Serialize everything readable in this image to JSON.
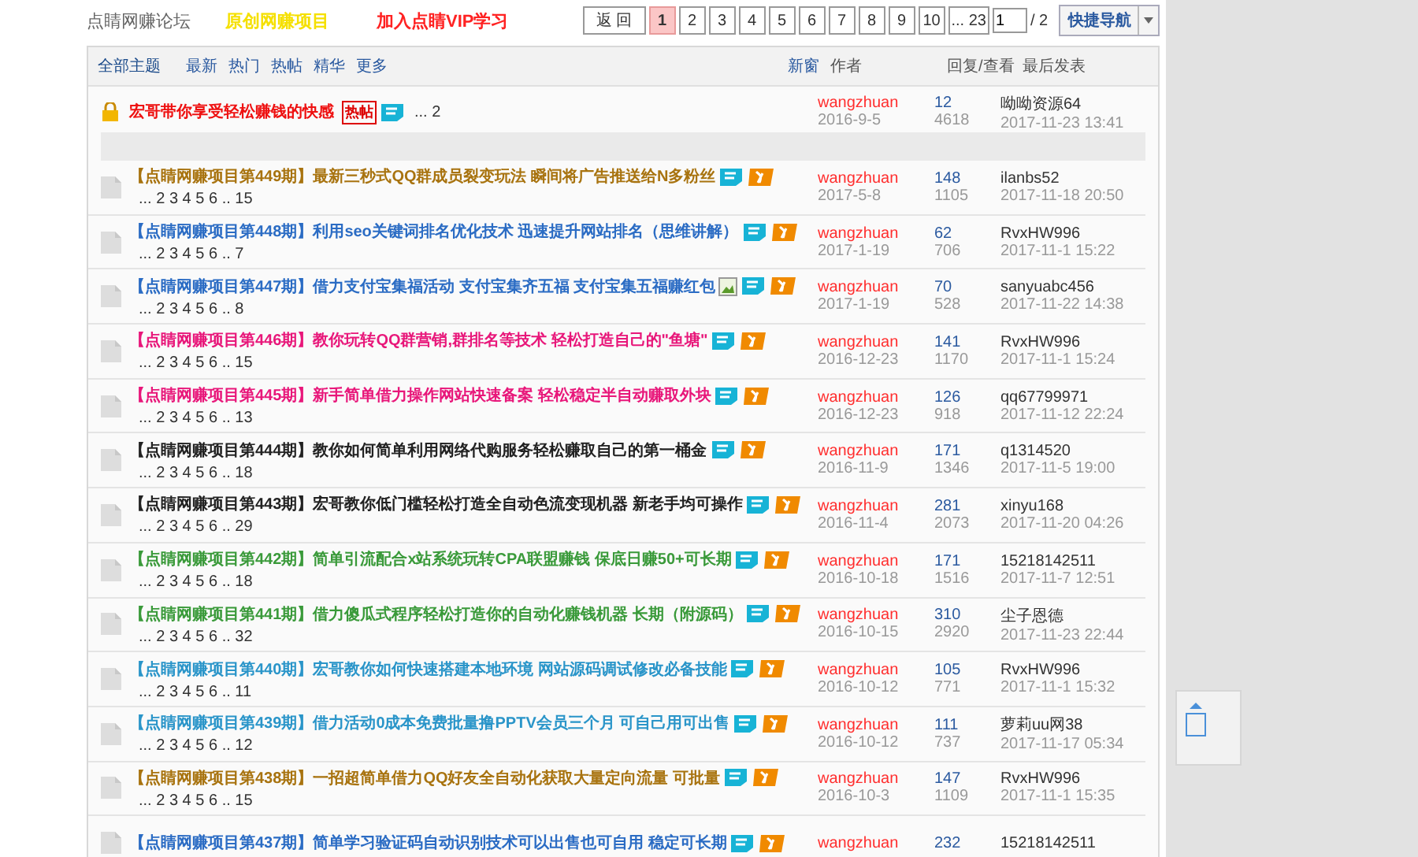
{
  "top_links": [
    {
      "label": "点睛网赚论坛",
      "color": "#666666"
    },
    {
      "label": "原创网赚项目",
      "color": "#f5e000"
    },
    {
      "label": "加入点睛VIP学习",
      "color": "#ff2222"
    }
  ],
  "pager": {
    "back": "返 回",
    "pages": [
      {
        "label": "1",
        "selected": true
      },
      {
        "label": "2",
        "selected": false
      },
      {
        "label": "3",
        "selected": false
      },
      {
        "label": "4",
        "selected": false
      },
      {
        "label": "5",
        "selected": false
      },
      {
        "label": "6",
        "selected": false
      },
      {
        "label": "7",
        "selected": false
      },
      {
        "label": "8",
        "selected": false
      },
      {
        "label": "9",
        "selected": false
      },
      {
        "label": "10",
        "selected": false
      },
      {
        "label": "... 23",
        "selected": false
      }
    ],
    "page_input": "1",
    "total": "/ 2",
    "quick_nav": "快捷导航"
  },
  "header": {
    "filters": [
      {
        "label": "全部主题",
        "selected": true
      },
      {
        "label": "最新",
        "selected": false
      },
      {
        "label": "热门",
        "selected": false
      },
      {
        "label": "热帖",
        "selected": false
      },
      {
        "label": "精华",
        "selected": false
      },
      {
        "label": "更多",
        "selected": false
      }
    ],
    "new_window": "新窗",
    "author": "作者",
    "replies_views": "回复/查看",
    "last_post": "最后发表"
  },
  "sticky": {
    "title": "宏哥带你享受轻松赚钱的快感",
    "tag": "热帖",
    "digest": true,
    "pages": "... 2",
    "author": "wangzhuan",
    "date": "2016-9-5",
    "replies": "12",
    "views": "4618",
    "last_user": "呦呦资源64",
    "last_time": "2017-11-23 13:41"
  },
  "threads": [
    {
      "prefix": "【点睛网赚项目第449期】",
      "title": "最新三秒式QQ群成员裂变玩法 瞬间将广告推送给N多粉丝",
      "color": "#a8730f",
      "has_image": false,
      "digest": true,
      "hot": true,
      "pages": "... 2 3 4 5 6 .. 15",
      "author": "wangzhuan",
      "date": "2017-5-8",
      "replies": "148",
      "views": "1105",
      "last_user": "ilanbs52",
      "last_time": "2017-11-18 20:50"
    },
    {
      "prefix": "【点睛网赚项目第448期】",
      "title": "利用seo关键词排名优化技术 迅速提升网站排名（思维讲解）",
      "color": "#2b6cc4",
      "has_image": false,
      "digest": true,
      "hot": true,
      "pages": "... 2 3 4 5 6 .. 7",
      "author": "wangzhuan",
      "date": "2017-1-19",
      "replies": "62",
      "views": "706",
      "last_user": "RvxHW996",
      "last_time": "2017-11-1 15:22"
    },
    {
      "prefix": "【点睛网赚项目第447期】",
      "title": "借力支付宝集福活动 支付宝集齐五福 支付宝集五福赚红包",
      "color": "#2b6cc4",
      "has_image": true,
      "digest": true,
      "hot": true,
      "pages": "... 2 3 4 5 6 .. 8",
      "author": "wangzhuan",
      "date": "2017-1-19",
      "replies": "70",
      "views": "528",
      "last_user": "sanyuabc456",
      "last_time": "2017-11-22 14:38"
    },
    {
      "prefix": "【点睛网赚项目第446期】",
      "title": "教你玩转QQ群营销,群排名等技术 轻松打造自己的\"鱼塘\"",
      "color": "#e8177a",
      "has_image": false,
      "digest": true,
      "hot": true,
      "pages": "... 2 3 4 5 6 .. 15",
      "author": "wangzhuan",
      "date": "2016-12-23",
      "replies": "141",
      "views": "1170",
      "last_user": "RvxHW996",
      "last_time": "2017-11-1 15:24"
    },
    {
      "prefix": "【点睛网赚项目第445期】",
      "title": "新手简单借力操作网站快速备案 轻松稳定半自动赚取外块",
      "color": "#e8177a",
      "has_image": false,
      "digest": true,
      "hot": true,
      "pages": "... 2 3 4 5 6 .. 13",
      "author": "wangzhuan",
      "date": "2016-12-23",
      "replies": "126",
      "views": "918",
      "last_user": "qq67799971",
      "last_time": "2017-11-12 22:24"
    },
    {
      "prefix": "【点睛网赚项目第444期】",
      "title": "教你如何简单利用网络代购服务轻松赚取自己的第一桶金",
      "color": "#222222",
      "has_image": false,
      "digest": true,
      "hot": true,
      "pages": "... 2 3 4 5 6 .. 18",
      "author": "wangzhuan",
      "date": "2016-11-9",
      "replies": "171",
      "views": "1346",
      "last_user": "q1314520",
      "last_time": "2017-11-5 19:00"
    },
    {
      "prefix": "【点睛网赚项目第443期】",
      "title": "宏哥教你低门槛轻松打造全自动色流变现机器 新老手均可操作",
      "color": "#222222",
      "has_image": false,
      "digest": true,
      "hot": true,
      "pages": "... 2 3 4 5 6 .. 29",
      "author": "wangzhuan",
      "date": "2016-11-4",
      "replies": "281",
      "views": "2073",
      "last_user": "xinyu168",
      "last_time": "2017-11-20 04:26"
    },
    {
      "prefix": "【点睛网赚项目第442期】",
      "title": "简单引流配合x站系统玩转CPA联盟赚钱 保底日赚50+可长期",
      "color": "#3a9a3a",
      "has_image": false,
      "digest": true,
      "hot": true,
      "pages": "... 2 3 4 5 6 .. 18",
      "author": "wangzhuan",
      "date": "2016-10-18",
      "replies": "171",
      "views": "1516",
      "last_user": "15218142511",
      "last_time": "2017-11-7 12:51"
    },
    {
      "prefix": "【点睛网赚项目第441期】",
      "title": "借力傻瓜式程序轻松打造你的自动化赚钱机器 长期（附源码）",
      "color": "#3a9a3a",
      "has_image": false,
      "digest": true,
      "hot": true,
      "pages": "... 2 3 4 5 6 .. 32",
      "author": "wangzhuan",
      "date": "2016-10-15",
      "replies": "310",
      "views": "2920",
      "last_user": "尘子恩德",
      "last_time": "2017-11-23 22:44"
    },
    {
      "prefix": "【点睛网赚项目第440期】",
      "title": "宏哥教你如何快速搭建本地环境 网站源码调试修改必备技能",
      "color": "#2a95c9",
      "has_image": false,
      "digest": true,
      "hot": true,
      "pages": "... 2 3 4 5 6 .. 11",
      "author": "wangzhuan",
      "date": "2016-10-12",
      "replies": "105",
      "views": "771",
      "last_user": "RvxHW996",
      "last_time": "2017-11-1 15:32"
    },
    {
      "prefix": "【点睛网赚项目第439期】",
      "title": "借力活动0成本免费批量撸PPTV会员三个月 可自己用可出售",
      "color": "#2a95c9",
      "has_image": false,
      "digest": true,
      "hot": true,
      "pages": "... 2 3 4 5 6 .. 12",
      "author": "wangzhuan",
      "date": "2016-10-12",
      "replies": "111",
      "views": "737",
      "last_user": "萝莉uu网38",
      "last_time": "2017-11-17 05:34"
    },
    {
      "prefix": "【点睛网赚项目第438期】",
      "title": "一招超简单借力QQ好友全自动化获取大量定向流量 可批量",
      "color": "#a8730f",
      "has_image": false,
      "digest": true,
      "hot": true,
      "pages": "... 2 3 4 5 6 .. 15",
      "author": "wangzhuan",
      "date": "2016-10-3",
      "replies": "147",
      "views": "1109",
      "last_user": "RvxHW996",
      "last_time": "2017-11-1 15:35"
    },
    {
      "prefix": "【点睛网赚项目第437期】",
      "title": "简单学习验证码自动识别技术可以出售也可自用 稳定可长期",
      "color": "#2b6cc4",
      "has_image": false,
      "digest": true,
      "hot": true,
      "author": "wangzhuan",
      "replies": "232",
      "last_user": "15218142511"
    }
  ]
}
